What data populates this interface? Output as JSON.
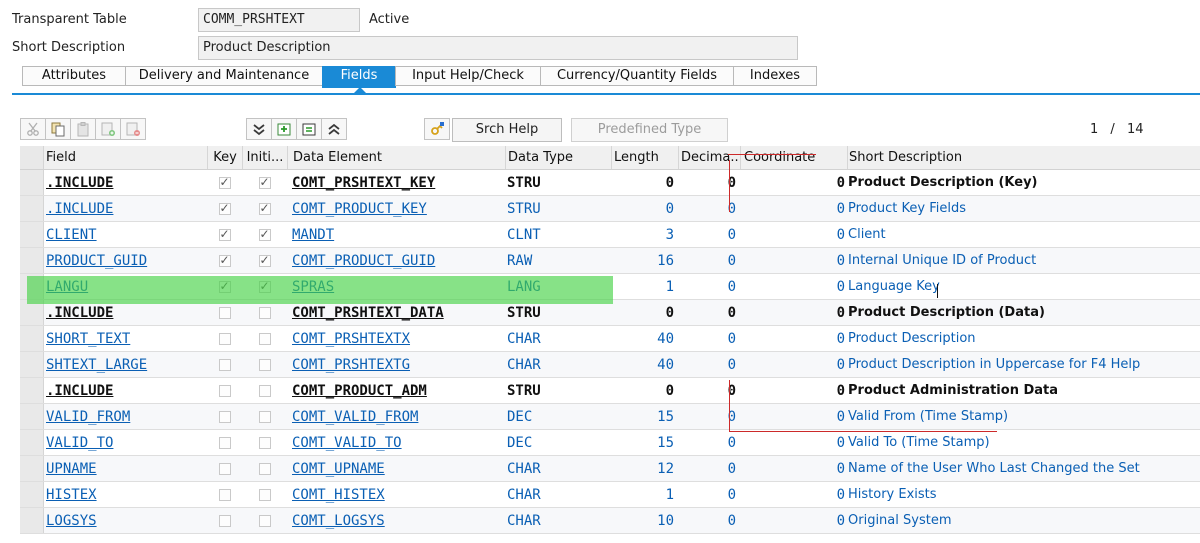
{
  "header": {
    "table_type_label": "Transparent Table",
    "table_name": "COMM_PRSHTEXT",
    "status": "Active",
    "short_desc_label": "Short Description",
    "short_desc_value": "Product Description"
  },
  "tabs": [
    {
      "label": "Attributes",
      "active": false
    },
    {
      "label": "Delivery and Maintenance",
      "active": false
    },
    {
      "label": "Fields",
      "active": true
    },
    {
      "label": "Input Help/Check",
      "active": false
    },
    {
      "label": "Currency/Quantity Fields",
      "active": false
    },
    {
      "label": "Indexes",
      "active": false
    }
  ],
  "toolbar": {
    "icons": [
      "cut-icon",
      "copy-icon",
      "paste-icon",
      "insert-row-icon",
      "delete-row-icon",
      "expand-all-icon",
      "insert-field-icon",
      "insert-field-alt-icon",
      "collapse-all-icon",
      "where-used-icon"
    ],
    "srch_help_label": "Srch Help",
    "predefined_type_label": "Predefined Type",
    "pager_current": "1",
    "pager_sep": "/",
    "pager_total": "14"
  },
  "columns": {
    "field": "Field",
    "key": "Key",
    "initial": "Initi...",
    "data_element": "Data Element",
    "data_type": "Data Type",
    "length": "Length",
    "decimal": "Decima...",
    "coordinate": "Coordinate",
    "short_description": "Short Description"
  },
  "rows": [
    {
      "field": ".INCLUDE",
      "key": true,
      "init": true,
      "de": "COMT_PRSHTEXT_KEY",
      "dt": "STRU",
      "len": "0",
      "dec": "0",
      "coord": "0",
      "desc": "Product Description (Key)",
      "style": "bold"
    },
    {
      "field": ".INCLUDE",
      "key": true,
      "init": true,
      "de": "COMT_PRODUCT_KEY",
      "dt": "STRU",
      "len": "0",
      "dec": "0",
      "coord": "0",
      "desc": "Product Key Fields",
      "style": "link"
    },
    {
      "field": "CLIENT",
      "key": true,
      "init": true,
      "de": "MANDT",
      "dt": "CLNT",
      "len": "3",
      "dec": "0",
      "coord": "0",
      "desc": "Client",
      "style": "link"
    },
    {
      "field": "PRODUCT_GUID",
      "key": true,
      "init": true,
      "de": "COMT_PRODUCT_GUID",
      "dt": "RAW",
      "len": "16",
      "dec": "0",
      "coord": "0",
      "desc": "Internal Unique ID of Product",
      "style": "link"
    },
    {
      "field": "LANGU",
      "key": true,
      "init": true,
      "de": "SPRAS",
      "dt": "LANG",
      "len": "1",
      "dec": "0",
      "coord": "0",
      "desc": "Language Key",
      "style": "link"
    },
    {
      "field": ".INCLUDE",
      "key": false,
      "init": false,
      "de": "COMT_PRSHTEXT_DATA",
      "dt": "STRU",
      "len": "0",
      "dec": "0",
      "coord": "0",
      "desc": "Product Description (Data)",
      "style": "bold"
    },
    {
      "field": "SHORT_TEXT",
      "key": false,
      "init": false,
      "de": "COMT_PRSHTEXTX",
      "dt": "CHAR",
      "len": "40",
      "dec": "0",
      "coord": "0",
      "desc": "Product Description",
      "style": "link"
    },
    {
      "field": "SHTEXT_LARGE",
      "key": false,
      "init": false,
      "de": "COMT_PRSHTEXTG",
      "dt": "CHAR",
      "len": "40",
      "dec": "0",
      "coord": "0",
      "desc": "Product Description in Uppercase for F4 Help",
      "style": "link"
    },
    {
      "field": ".INCLUDE",
      "key": false,
      "init": false,
      "de": "COMT_PRODUCT_ADM",
      "dt": "STRU",
      "len": "0",
      "dec": "0",
      "coord": "0",
      "desc": "Product Administration Data",
      "style": "bold"
    },
    {
      "field": "VALID_FROM",
      "key": false,
      "init": false,
      "de": "COMT_VALID_FROM",
      "dt": "DEC",
      "len": "15",
      "dec": "0",
      "coord": "0",
      "desc": "Valid From (Time Stamp)",
      "style": "link"
    },
    {
      "field": "VALID_TO",
      "key": false,
      "init": false,
      "de": "COMT_VALID_TO",
      "dt": "DEC",
      "len": "15",
      "dec": "0",
      "coord": "0",
      "desc": "Valid To (Time Stamp)",
      "style": "link"
    },
    {
      "field": "UPNAME",
      "key": false,
      "init": false,
      "de": "COMT_UPNAME",
      "dt": "CHAR",
      "len": "12",
      "dec": "0",
      "coord": "0",
      "desc": "Name of the User Who Last Changed the Set",
      "style": "link"
    },
    {
      "field": "HISTEX",
      "key": false,
      "init": false,
      "de": "COMT_HISTEX",
      "dt": "CHAR",
      "len": "1",
      "dec": "0",
      "coord": "0",
      "desc": "History Exists",
      "style": "link"
    },
    {
      "field": "LOGSYS",
      "key": false,
      "init": false,
      "de": "COMT_LOGSYS",
      "dt": "CHAR",
      "len": "10",
      "dec": "0",
      "coord": "0",
      "desc": "Original System",
      "style": "link"
    }
  ],
  "colors": {
    "accent": "#1a8ad6",
    "link": "#0a5fb4",
    "highlight": "#46d246",
    "annotation": "#cc2a2a"
  }
}
